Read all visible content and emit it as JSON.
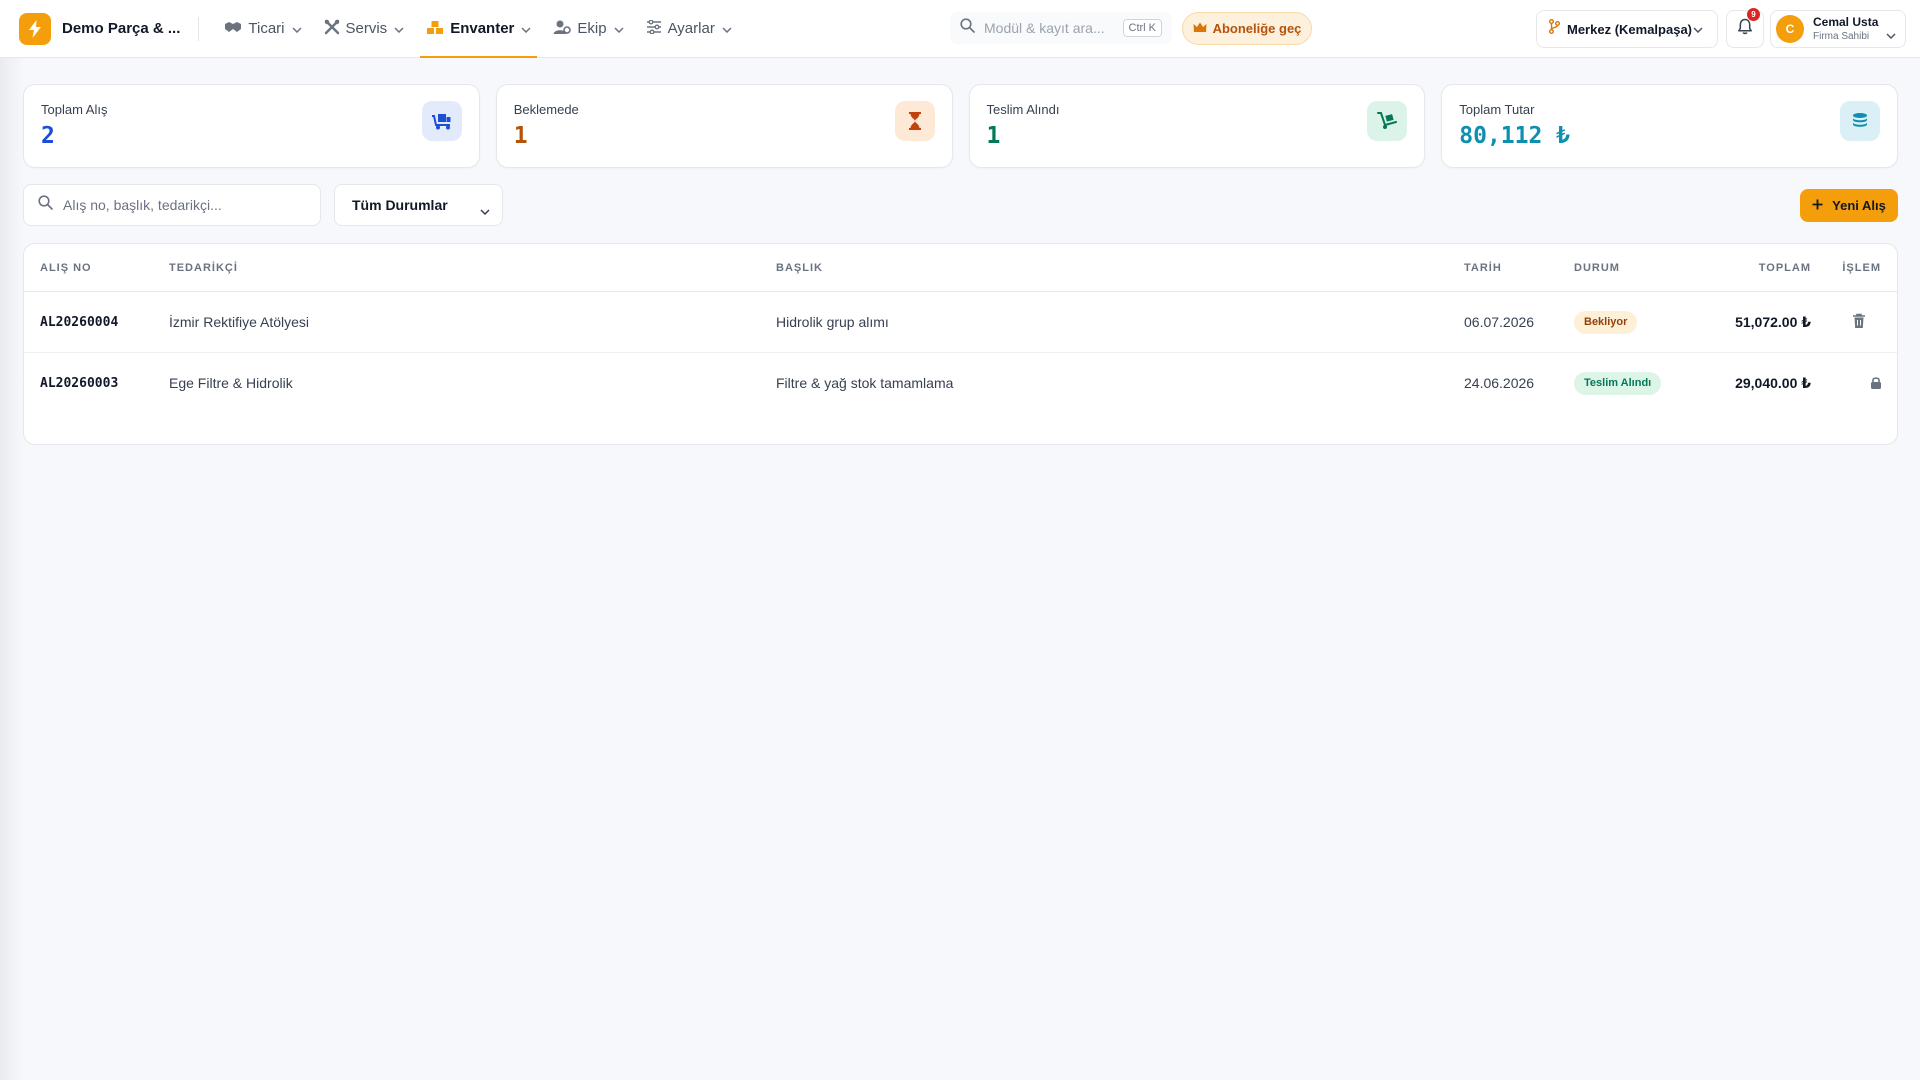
{
  "app": {
    "brand_name": "Demo Parça & ...",
    "brand_icon": "lightning-icon",
    "accent": "#f59e0b"
  },
  "nav": [
    {
      "label": "Ticari",
      "icon": "handshake-icon"
    },
    {
      "label": "Servis",
      "icon": "tools-icon"
    },
    {
      "label": "Envanter",
      "icon": "boxes-icon",
      "active": true
    },
    {
      "label": "Ekip",
      "icon": "team-icon"
    },
    {
      "label": "Ayarlar",
      "icon": "sliders-icon"
    }
  ],
  "search": {
    "placeholder": "Modül & kayıt ara...",
    "shortcut": "Ctrl K"
  },
  "upgrade": {
    "label": "Aboneliğe geç",
    "icon": "crown-icon"
  },
  "branch": {
    "label": "Merkez (Kemalpaşa)",
    "icon": "branch-icon"
  },
  "notifications": {
    "count": "9"
  },
  "user": {
    "initial": "C",
    "name": "Cemal Usta",
    "role": "Firma Sahibi"
  },
  "stats": [
    {
      "label": "Toplam Alış",
      "value": "2",
      "color": "#1d4ed8",
      "icon": "truck-icon",
      "icon_bg": "#e3eafc"
    },
    {
      "label": "Beklemede",
      "value": "1",
      "color": "#b45309",
      "icon": "hourglass-icon",
      "icon_bg": "#fde9d6"
    },
    {
      "label": "Teslim Alındı",
      "value": "1",
      "color": "#047857",
      "icon": "dolly-icon",
      "icon_bg": "#dcf3e9"
    },
    {
      "label": "Toplam Tutar",
      "value": "80,112 ₺",
      "color": "#0e8fb0",
      "icon": "coins-icon",
      "icon_bg": "#dbf0f6"
    }
  ],
  "filters": {
    "search_placeholder": "Alış no, başlık, tedarikçi...",
    "status_label": "Tüm Durumlar",
    "new_button": "Yeni Alış"
  },
  "table": {
    "headers": {
      "no": "ALIŞ NO",
      "supplier": "TEDARİKÇİ",
      "title": "BAŞLIK",
      "date": "TARİH",
      "status": "DURUM",
      "total": "TOPLAM",
      "action": "İŞLEM"
    },
    "rows": [
      {
        "no": "AL20260004",
        "supplier": "İzmir Rektifiye Atölyesi",
        "title": "Hidrolik grup alımı",
        "date": "06.07.2026",
        "status": "Bekliyor",
        "total": "51,072.00 ₺",
        "action_icon": "trash-icon"
      },
      {
        "no": "AL20260003",
        "supplier": "Ege Filtre & Hidrolik",
        "title": "Filtre & yağ stok tamamlama",
        "date": "24.06.2026",
        "status": "Teslim Alındı",
        "total": "29,040.00 ₺",
        "action_icon": "lock-icon"
      }
    ]
  }
}
